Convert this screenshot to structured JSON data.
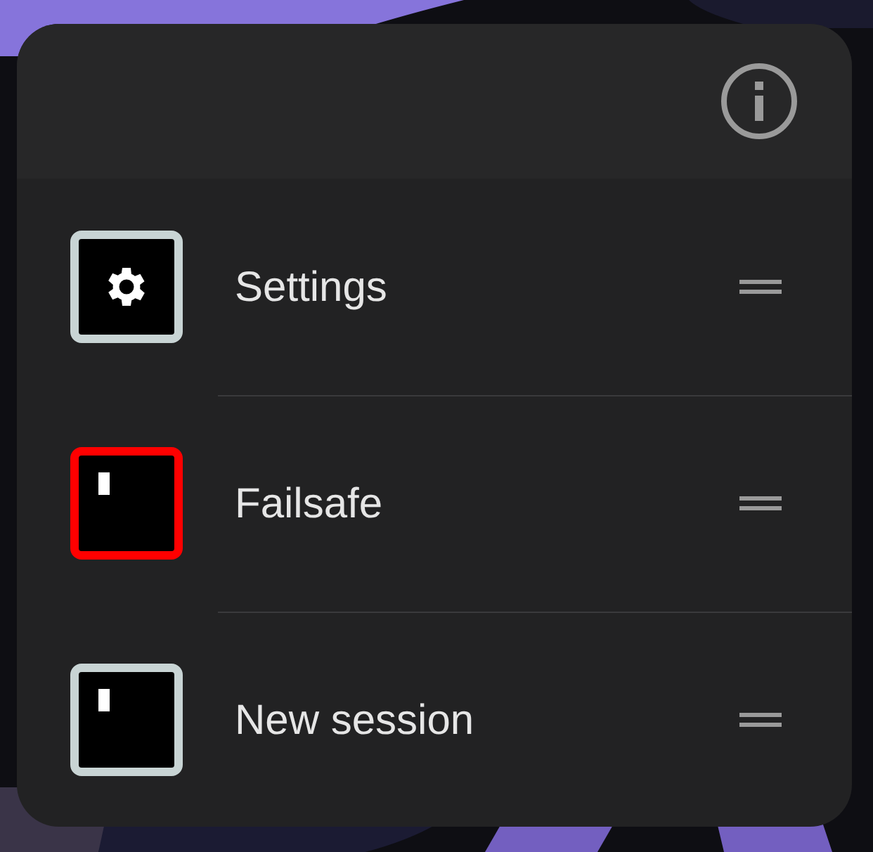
{
  "shortcuts": [
    {
      "label": "Settings",
      "kind": "settings",
      "color": "#c8d4d4"
    },
    {
      "label": "Failsafe",
      "kind": "session",
      "color": "#ff0000"
    },
    {
      "label": "New session",
      "kind": "session",
      "color": "#c8d4d4"
    }
  ]
}
